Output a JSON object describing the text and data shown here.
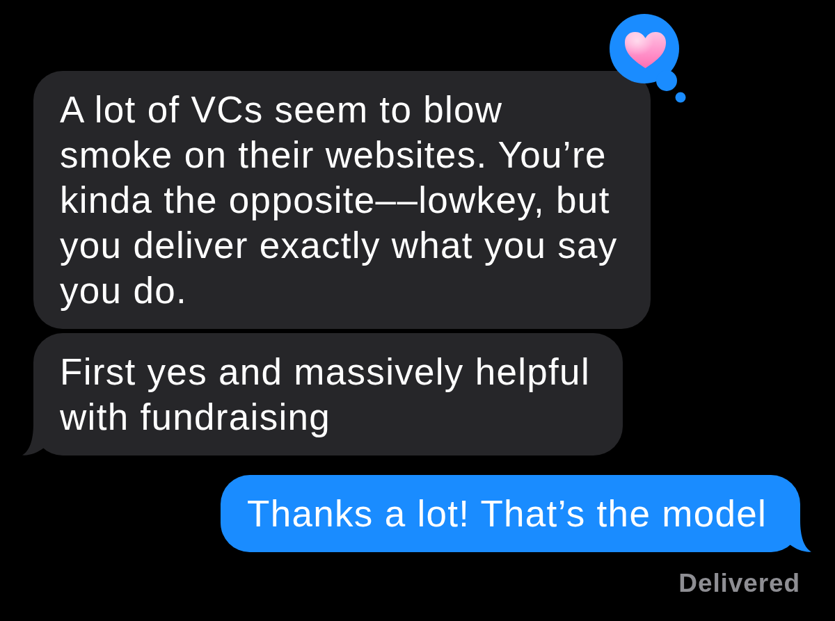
{
  "messages": [
    {
      "kind": "incoming",
      "text": "A lot of VCs seem to blow smoke on their websites. You’re kinda the opposite––lowkey, but you deliver exactly what you say you do.",
      "tail": false,
      "tapback": true
    },
    {
      "kind": "incoming",
      "text": "First yes and massively helpful with fundraising",
      "tail": true,
      "tapback": false
    },
    {
      "kind": "outgoing",
      "text": "Thanks a lot! That’s the model",
      "tail": true,
      "tapback": false
    }
  ],
  "status": "Delivered"
}
